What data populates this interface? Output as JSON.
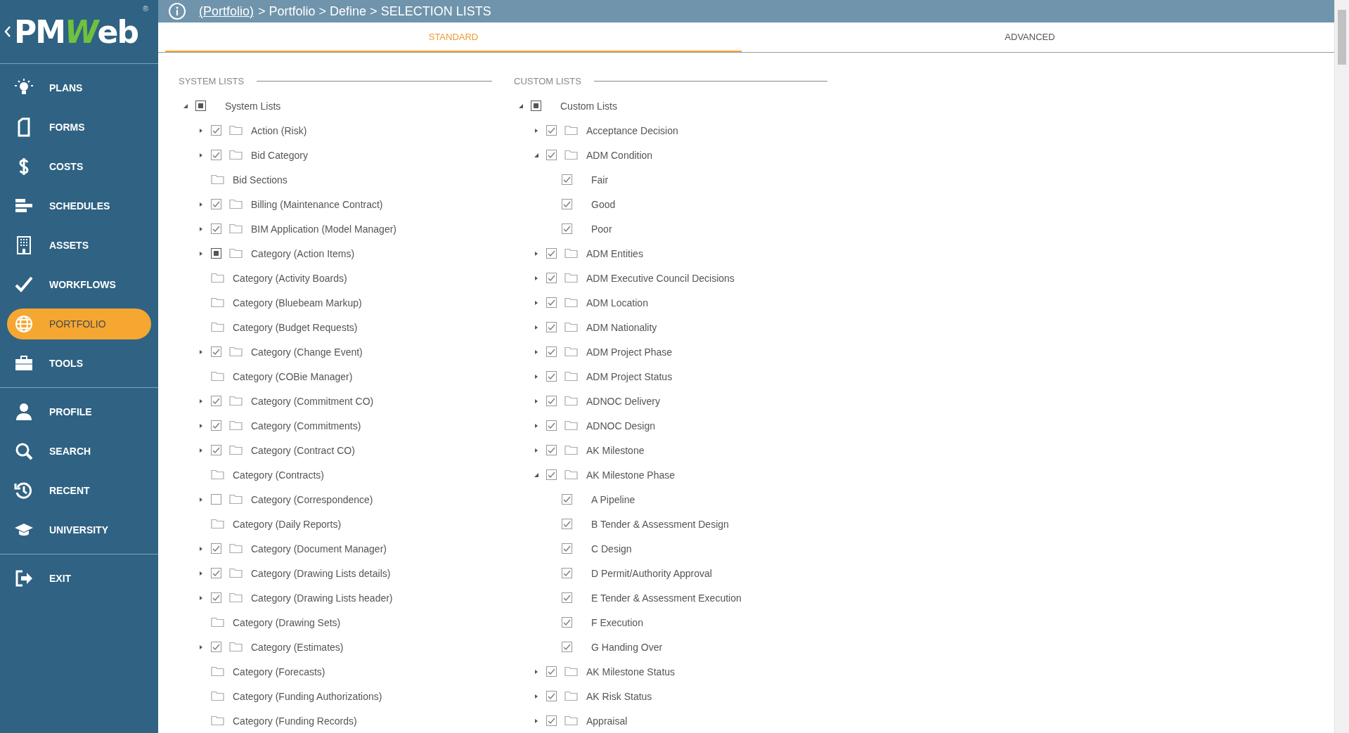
{
  "logo": {
    "prefix": "PM",
    "highlight": "W",
    "suffix": "eb",
    "mark": "®"
  },
  "sidebar": {
    "groups": [
      {
        "items": [
          {
            "label": "PLANS",
            "kind": "bulb",
            "selected": false
          },
          {
            "label": "FORMS",
            "kind": "form",
            "selected": false
          },
          {
            "label": "COSTS",
            "kind": "dollar",
            "selected": false
          },
          {
            "label": "SCHEDULES",
            "kind": "bars",
            "selected": false
          },
          {
            "label": "ASSETS",
            "kind": "building",
            "selected": false
          },
          {
            "label": "WORKFLOWS",
            "kind": "check",
            "selected": false
          },
          {
            "label": "PORTFOLIO",
            "kind": "globe",
            "selected": true
          },
          {
            "label": "TOOLS",
            "kind": "toolbox",
            "selected": false
          }
        ]
      },
      {
        "items": [
          {
            "label": "PROFILE",
            "kind": "person",
            "selected": false
          },
          {
            "label": "SEARCH",
            "kind": "search",
            "selected": false
          },
          {
            "label": "RECENT",
            "kind": "history",
            "selected": false
          },
          {
            "label": "UNIVERSITY",
            "kind": "cap",
            "selected": false
          }
        ]
      },
      {
        "items": [
          {
            "label": "EXIT",
            "kind": "exit",
            "selected": false
          }
        ]
      }
    ]
  },
  "breadcrumb": {
    "link": "(Portfolio)",
    "path": "> Portfolio > Define > SELECTION LISTS"
  },
  "tabs": [
    {
      "label": "STANDARD",
      "selected": true
    },
    {
      "label": "ADVANCED",
      "selected": false
    }
  ],
  "panels": [
    {
      "title": "SYSTEM LISTS",
      "tree": [
        {
          "label": "System Lists",
          "expanded": true,
          "checked": true,
          "partial": true,
          "folder": false,
          "children": [
            {
              "label": "Action (Risk)",
              "expanded": false,
              "checked": true,
              "partial": false,
              "folder": true
            },
            {
              "label": "Bid Category",
              "expanded": false,
              "checked": true,
              "partial": false,
              "folder": true
            },
            {
              "label": "Bid Sections",
              "folder": true
            },
            {
              "label": "Billing (Maintenance Contract)",
              "expanded": false,
              "checked": true,
              "partial": false,
              "folder": true
            },
            {
              "label": "BIM Application (Model Manager)",
              "expanded": false,
              "checked": true,
              "partial": false,
              "folder": true
            },
            {
              "label": "Category (Action Items)",
              "expanded": false,
              "checked": true,
              "partial": true,
              "folder": true
            },
            {
              "label": "Category (Activity Boards)",
              "folder": true
            },
            {
              "label": "Category (Bluebeam Markup)",
              "folder": true
            },
            {
              "label": "Category (Budget Requests)",
              "folder": true
            },
            {
              "label": "Category (Change Event)",
              "expanded": false,
              "checked": true,
              "partial": false,
              "folder": true
            },
            {
              "label": "Category (COBie Manager)",
              "folder": true
            },
            {
              "label": "Category (Commitment CO)",
              "expanded": false,
              "checked": true,
              "partial": false,
              "folder": true
            },
            {
              "label": "Category (Commitments)",
              "expanded": false,
              "checked": true,
              "partial": false,
              "folder": true
            },
            {
              "label": "Category (Contract CO)",
              "expanded": false,
              "checked": true,
              "partial": false,
              "folder": true
            },
            {
              "label": "Category (Contracts)",
              "folder": true
            },
            {
              "label": "Category (Correspondence)",
              "expanded": false,
              "checked": false,
              "partial": false,
              "folder": true
            },
            {
              "label": "Category (Daily Reports)",
              "folder": true
            },
            {
              "label": "Category (Document Manager)",
              "expanded": false,
              "checked": true,
              "partial": false,
              "folder": true
            },
            {
              "label": "Category (Drawing Lists details)",
              "expanded": false,
              "checked": true,
              "partial": false,
              "folder": true
            },
            {
              "label": "Category (Drawing Lists header)",
              "expanded": false,
              "checked": true,
              "partial": false,
              "folder": true
            },
            {
              "label": "Category (Drawing Sets)",
              "folder": true
            },
            {
              "label": "Category (Estimates)",
              "expanded": false,
              "checked": true,
              "partial": false,
              "folder": true
            },
            {
              "label": "Category (Forecasts)",
              "folder": true
            },
            {
              "label": "Category (Funding Authorizations)",
              "folder": true
            },
            {
              "label": "Category (Funding Records)",
              "folder": true
            }
          ]
        }
      ]
    },
    {
      "title": "CUSTOM LISTS",
      "tree": [
        {
          "label": "Custom Lists",
          "expanded": true,
          "checked": true,
          "partial": true,
          "folder": false,
          "children": [
            {
              "label": "Acceptance Decision",
              "expanded": false,
              "checked": true,
              "partial": false,
              "folder": true
            },
            {
              "label": "ADM Condition",
              "expanded": true,
              "checked": true,
              "partial": false,
              "folder": true,
              "children": [
                {
                  "label": "Fair",
                  "checked": true,
                  "partial": false,
                  "folder": false
                },
                {
                  "label": "Good",
                  "checked": true,
                  "partial": false,
                  "folder": false
                },
                {
                  "label": "Poor",
                  "checked": true,
                  "partial": false,
                  "folder": false
                }
              ]
            },
            {
              "label": "ADM Entities",
              "expanded": false,
              "checked": true,
              "partial": false,
              "folder": true
            },
            {
              "label": "ADM Executive Council Decisions",
              "expanded": false,
              "checked": true,
              "partial": false,
              "folder": true
            },
            {
              "label": "ADM Location",
              "expanded": false,
              "checked": true,
              "partial": false,
              "folder": true
            },
            {
              "label": "ADM Nationality",
              "expanded": false,
              "checked": true,
              "partial": false,
              "folder": true
            },
            {
              "label": "ADM Project Phase",
              "expanded": false,
              "checked": true,
              "partial": false,
              "folder": true
            },
            {
              "label": "ADM Project Status",
              "expanded": false,
              "checked": true,
              "partial": false,
              "folder": true
            },
            {
              "label": "ADNOC Delivery",
              "expanded": false,
              "checked": true,
              "partial": false,
              "folder": true
            },
            {
              "label": "ADNOC Design",
              "expanded": false,
              "checked": true,
              "partial": false,
              "folder": true
            },
            {
              "label": "AK Milestone",
              "expanded": false,
              "checked": true,
              "partial": false,
              "folder": true
            },
            {
              "label": "AK Milestone Phase",
              "expanded": true,
              "checked": true,
              "partial": false,
              "folder": true,
              "children": [
                {
                  "label": "A Pipeline",
                  "checked": true,
                  "partial": false,
                  "folder": false
                },
                {
                  "label": "B Tender & Assessment Design",
                  "checked": true,
                  "partial": false,
                  "folder": false
                },
                {
                  "label": "C Design",
                  "checked": true,
                  "partial": false,
                  "folder": false
                },
                {
                  "label": "D Permit/Authority Approval",
                  "checked": true,
                  "partial": false,
                  "folder": false
                },
                {
                  "label": "E Tender & Assessment Execution",
                  "checked": true,
                  "partial": false,
                  "folder": false
                },
                {
                  "label": "F Execution",
                  "checked": true,
                  "partial": false,
                  "folder": false
                },
                {
                  "label": "G Handing Over",
                  "checked": true,
                  "partial": false,
                  "folder": false
                }
              ]
            },
            {
              "label": "AK Milestone Status",
              "expanded": false,
              "checked": true,
              "partial": false,
              "folder": true
            },
            {
              "label": "AK Risk Status",
              "expanded": false,
              "checked": true,
              "partial": false,
              "folder": true
            },
            {
              "label": "Appraisal",
              "expanded": false,
              "checked": true,
              "partial": false,
              "folder": true
            }
          ]
        }
      ]
    }
  ]
}
